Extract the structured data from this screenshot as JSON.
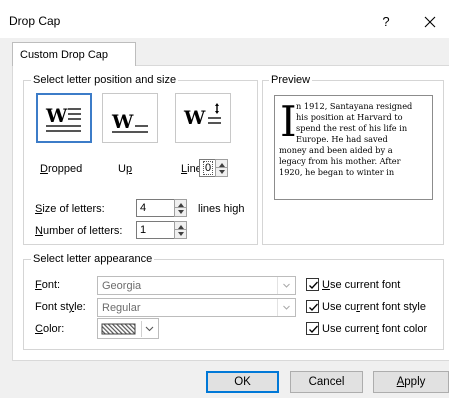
{
  "window": {
    "title": "Drop Cap",
    "help_label": "?",
    "close_icon": "close-icon"
  },
  "tab": {
    "label": "Custom Drop Cap"
  },
  "position_group": {
    "label": "Select letter position and size",
    "options": [
      {
        "label_pre": "",
        "label_u": "D",
        "label_post": "ropped",
        "selected": true,
        "icon": "dropped-icon"
      },
      {
        "label_pre": "U",
        "label_u": "p",
        "label_post": "",
        "selected": false,
        "icon": "up-icon"
      },
      {
        "label_pre": "",
        "label_u": "L",
        "label_post": "ines",
        "selected": false,
        "icon": "lines-icon"
      }
    ],
    "lines_value": "0",
    "size": {
      "label_pre": "",
      "label_u": "S",
      "label_post": "ize of letters:",
      "value": "4",
      "unit": "lines high"
    },
    "number": {
      "label_pre": "",
      "label_u": "N",
      "label_post": "umber of letters:",
      "value": "1"
    }
  },
  "preview": {
    "label": "Preview",
    "drop_letter": "I",
    "lines": [
      "n 1912, Santayana resigned",
      "his position at Harvard to",
      "spend the rest of his life in",
      "Europe. He had saved",
      "money and been aided by a",
      "legacy from his mother. After",
      "1920, he began to winter in"
    ]
  },
  "appearance_group": {
    "label": "Select letter appearance",
    "font": {
      "label_pre": "",
      "label_u": "F",
      "label_post": "ont:",
      "value": "Georgia"
    },
    "font_style": {
      "label_pre": "Font st",
      "label_u": "y",
      "label_post": "le:",
      "value": "Regular"
    },
    "color": {
      "label_pre": "",
      "label_u": "C",
      "label_post": "olor:"
    },
    "checks": [
      {
        "label_pre": "",
        "label_u": "U",
        "label_post": "se current font",
        "checked": true
      },
      {
        "label_pre": "Use cu",
        "label_u": "r",
        "label_post": "rent font style",
        "checked": true
      },
      {
        "label_pre": "Use curren",
        "label_u": "t",
        "label_post": " font color",
        "checked": true
      }
    ]
  },
  "buttons": {
    "ok": "OK",
    "cancel": "Cancel",
    "apply_pre": "",
    "apply_u": "A",
    "apply_post": "pply"
  },
  "colors": {
    "accent": "#0078d7",
    "selected_border": "#3c7cc8",
    "disabled_text": "#6d6d6d"
  }
}
